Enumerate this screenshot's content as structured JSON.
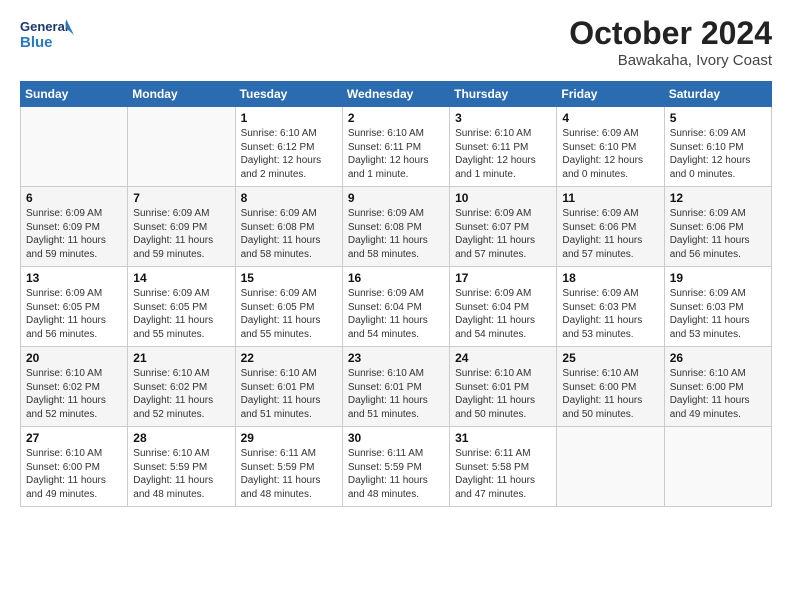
{
  "logo": {
    "line1": "General",
    "line2": "Blue"
  },
  "header": {
    "month": "October 2024",
    "location": "Bawakaha, Ivory Coast"
  },
  "weekdays": [
    "Sunday",
    "Monday",
    "Tuesday",
    "Wednesday",
    "Thursday",
    "Friday",
    "Saturday"
  ],
  "weeks": [
    [
      {
        "day": "",
        "info": ""
      },
      {
        "day": "",
        "info": ""
      },
      {
        "day": "1",
        "info": "Sunrise: 6:10 AM\nSunset: 6:12 PM\nDaylight: 12 hours\nand 2 minutes."
      },
      {
        "day": "2",
        "info": "Sunrise: 6:10 AM\nSunset: 6:11 PM\nDaylight: 12 hours\nand 1 minute."
      },
      {
        "day": "3",
        "info": "Sunrise: 6:10 AM\nSunset: 6:11 PM\nDaylight: 12 hours\nand 1 minute."
      },
      {
        "day": "4",
        "info": "Sunrise: 6:09 AM\nSunset: 6:10 PM\nDaylight: 12 hours\nand 0 minutes."
      },
      {
        "day": "5",
        "info": "Sunrise: 6:09 AM\nSunset: 6:10 PM\nDaylight: 12 hours\nand 0 minutes."
      }
    ],
    [
      {
        "day": "6",
        "info": "Sunrise: 6:09 AM\nSunset: 6:09 PM\nDaylight: 11 hours\nand 59 minutes."
      },
      {
        "day": "7",
        "info": "Sunrise: 6:09 AM\nSunset: 6:09 PM\nDaylight: 11 hours\nand 59 minutes."
      },
      {
        "day": "8",
        "info": "Sunrise: 6:09 AM\nSunset: 6:08 PM\nDaylight: 11 hours\nand 58 minutes."
      },
      {
        "day": "9",
        "info": "Sunrise: 6:09 AM\nSunset: 6:08 PM\nDaylight: 11 hours\nand 58 minutes."
      },
      {
        "day": "10",
        "info": "Sunrise: 6:09 AM\nSunset: 6:07 PM\nDaylight: 11 hours\nand 57 minutes."
      },
      {
        "day": "11",
        "info": "Sunrise: 6:09 AM\nSunset: 6:06 PM\nDaylight: 11 hours\nand 57 minutes."
      },
      {
        "day": "12",
        "info": "Sunrise: 6:09 AM\nSunset: 6:06 PM\nDaylight: 11 hours\nand 56 minutes."
      }
    ],
    [
      {
        "day": "13",
        "info": "Sunrise: 6:09 AM\nSunset: 6:05 PM\nDaylight: 11 hours\nand 56 minutes."
      },
      {
        "day": "14",
        "info": "Sunrise: 6:09 AM\nSunset: 6:05 PM\nDaylight: 11 hours\nand 55 minutes."
      },
      {
        "day": "15",
        "info": "Sunrise: 6:09 AM\nSunset: 6:05 PM\nDaylight: 11 hours\nand 55 minutes."
      },
      {
        "day": "16",
        "info": "Sunrise: 6:09 AM\nSunset: 6:04 PM\nDaylight: 11 hours\nand 54 minutes."
      },
      {
        "day": "17",
        "info": "Sunrise: 6:09 AM\nSunset: 6:04 PM\nDaylight: 11 hours\nand 54 minutes."
      },
      {
        "day": "18",
        "info": "Sunrise: 6:09 AM\nSunset: 6:03 PM\nDaylight: 11 hours\nand 53 minutes."
      },
      {
        "day": "19",
        "info": "Sunrise: 6:09 AM\nSunset: 6:03 PM\nDaylight: 11 hours\nand 53 minutes."
      }
    ],
    [
      {
        "day": "20",
        "info": "Sunrise: 6:10 AM\nSunset: 6:02 PM\nDaylight: 11 hours\nand 52 minutes."
      },
      {
        "day": "21",
        "info": "Sunrise: 6:10 AM\nSunset: 6:02 PM\nDaylight: 11 hours\nand 52 minutes."
      },
      {
        "day": "22",
        "info": "Sunrise: 6:10 AM\nSunset: 6:01 PM\nDaylight: 11 hours\nand 51 minutes."
      },
      {
        "day": "23",
        "info": "Sunrise: 6:10 AM\nSunset: 6:01 PM\nDaylight: 11 hours\nand 51 minutes."
      },
      {
        "day": "24",
        "info": "Sunrise: 6:10 AM\nSunset: 6:01 PM\nDaylight: 11 hours\nand 50 minutes."
      },
      {
        "day": "25",
        "info": "Sunrise: 6:10 AM\nSunset: 6:00 PM\nDaylight: 11 hours\nand 50 minutes."
      },
      {
        "day": "26",
        "info": "Sunrise: 6:10 AM\nSunset: 6:00 PM\nDaylight: 11 hours\nand 49 minutes."
      }
    ],
    [
      {
        "day": "27",
        "info": "Sunrise: 6:10 AM\nSunset: 6:00 PM\nDaylight: 11 hours\nand 49 minutes."
      },
      {
        "day": "28",
        "info": "Sunrise: 6:10 AM\nSunset: 5:59 PM\nDaylight: 11 hours\nand 48 minutes."
      },
      {
        "day": "29",
        "info": "Sunrise: 6:11 AM\nSunset: 5:59 PM\nDaylight: 11 hours\nand 48 minutes."
      },
      {
        "day": "30",
        "info": "Sunrise: 6:11 AM\nSunset: 5:59 PM\nDaylight: 11 hours\nand 48 minutes."
      },
      {
        "day": "31",
        "info": "Sunrise: 6:11 AM\nSunset: 5:58 PM\nDaylight: 11 hours\nand 47 minutes."
      },
      {
        "day": "",
        "info": ""
      },
      {
        "day": "",
        "info": ""
      }
    ]
  ]
}
